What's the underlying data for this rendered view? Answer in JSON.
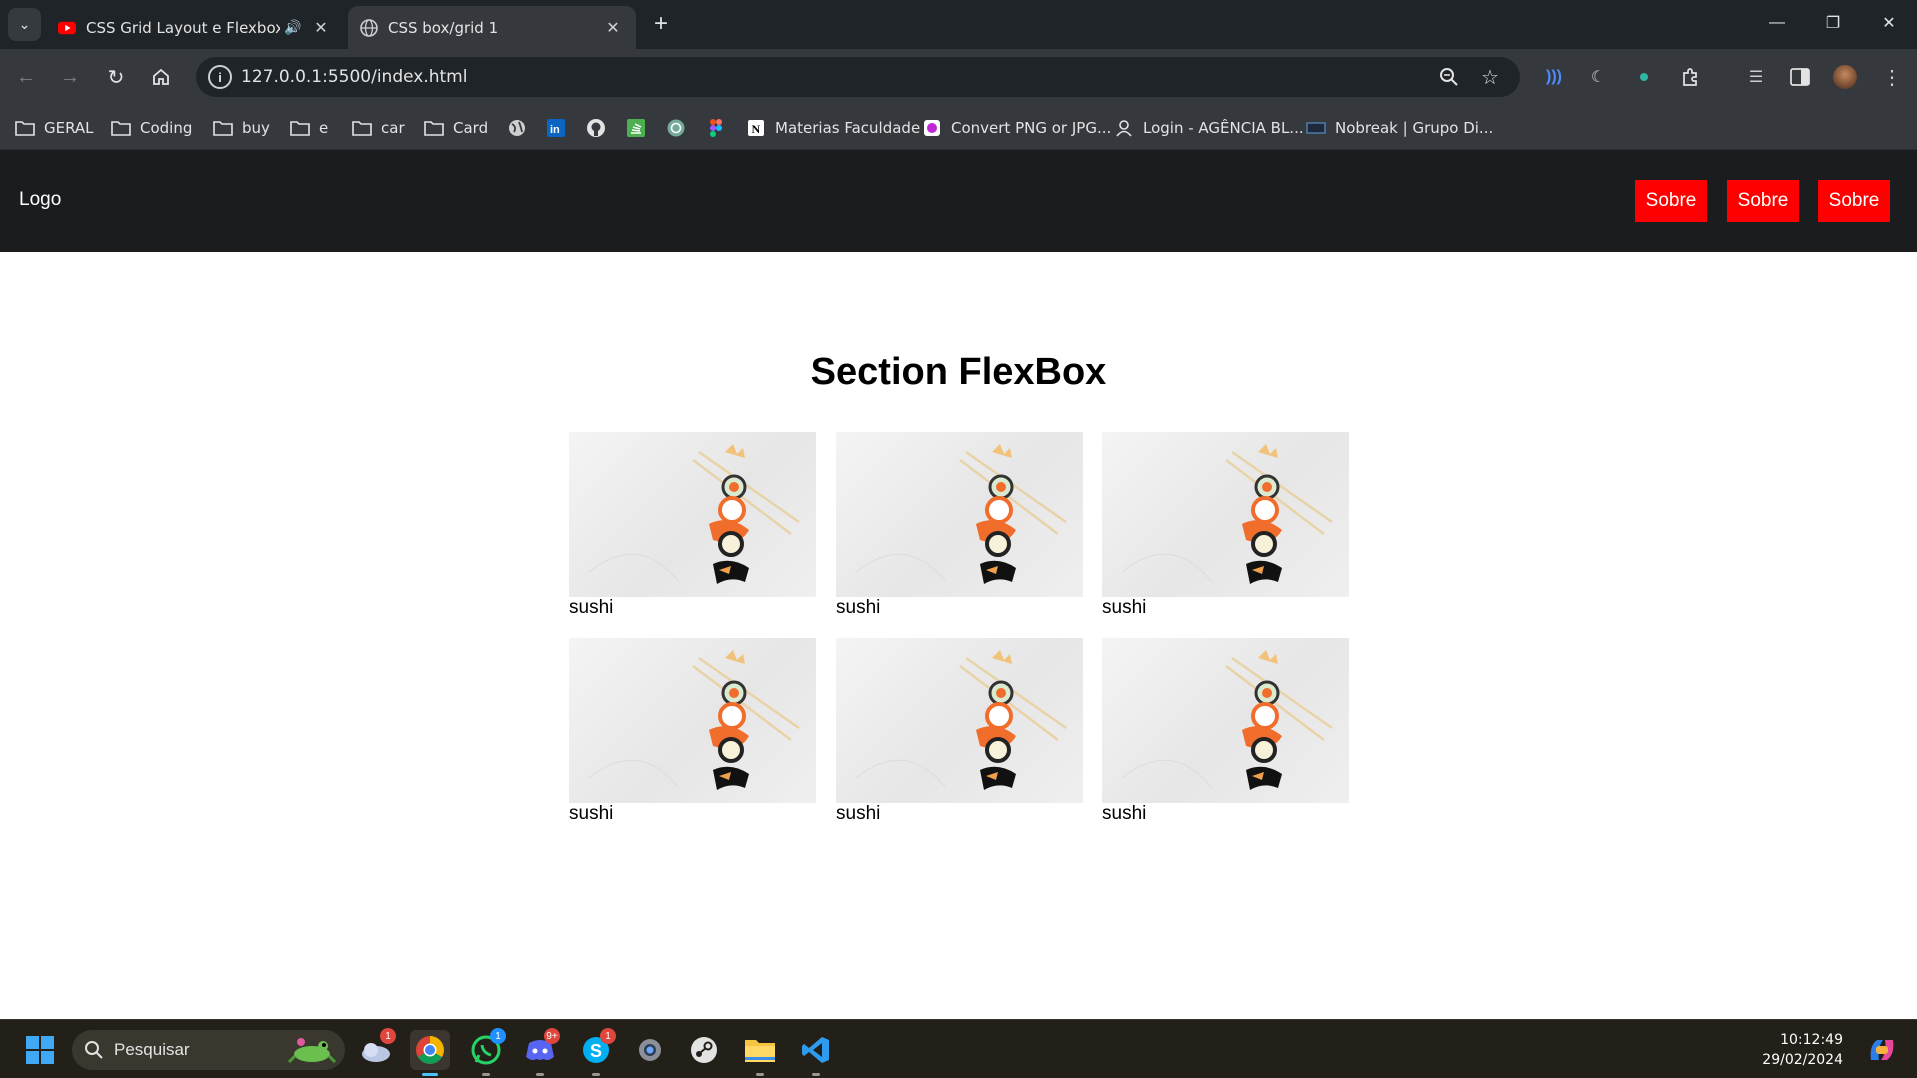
{
  "browser": {
    "tabs": [
      {
        "title": "CSS Grid Layout e Flexbox -",
        "favicon": "youtube-icon",
        "audio": true,
        "active": false
      },
      {
        "title": "CSS box/grid 1",
        "favicon": "globe-icon",
        "audio": false,
        "active": true
      }
    ],
    "address": "127.0.0.1:5500/index.html",
    "bookmarks": [
      {
        "label": "GERAL",
        "icon": "folder-icon"
      },
      {
        "label": "Coding",
        "icon": "folder-icon"
      },
      {
        "label": "buy",
        "icon": "folder-icon"
      },
      {
        "label": "e",
        "icon": "folder-icon"
      },
      {
        "label": "car",
        "icon": "folder-icon"
      },
      {
        "label": "Card",
        "icon": "folder-icon"
      },
      {
        "label": "",
        "icon": "globe-icon"
      },
      {
        "label": "",
        "icon": "linkedin-icon"
      },
      {
        "label": "",
        "icon": "github-icon"
      },
      {
        "label": "",
        "icon": "stackoverflow-icon"
      },
      {
        "label": "",
        "icon": "chatgpt-icon"
      },
      {
        "label": "",
        "icon": "figma-icon"
      },
      {
        "label": "Materias Faculdade",
        "icon": "notion-icon"
      },
      {
        "label": "Convert PNG or JPG...",
        "icon": "converter-icon"
      },
      {
        "label": "Login - AGÊNCIA BL...",
        "icon": "login-icon"
      },
      {
        "label": "Nobreak | Grupo Di...",
        "icon": "nobreak-icon"
      }
    ]
  },
  "site": {
    "logo": "Logo",
    "nav": [
      "Sobre",
      "Sobre",
      "Sobre"
    ],
    "section_title": "Section FlexBox",
    "cards": [
      {
        "caption": "sushi"
      },
      {
        "caption": "sushi"
      },
      {
        "caption": "sushi"
      },
      {
        "caption": "sushi"
      },
      {
        "caption": "sushi"
      },
      {
        "caption": "sushi"
      }
    ]
  },
  "taskbar": {
    "search_placeholder": "Pesquisar",
    "apps": [
      {
        "name": "weather-icon",
        "badge": "1"
      },
      {
        "name": "chrome-icon",
        "badge": "",
        "active": true
      },
      {
        "name": "whatsapp-icon",
        "badge": "1"
      },
      {
        "name": "discord-icon",
        "badge": "9+"
      },
      {
        "name": "skype-icon",
        "badge": "1"
      },
      {
        "name": "settings-icon",
        "badge": ""
      },
      {
        "name": "steam-icon",
        "badge": ""
      },
      {
        "name": "file-explorer-icon",
        "badge": ""
      },
      {
        "name": "vscode-icon",
        "badge": ""
      }
    ],
    "time": "10:12:49",
    "date": "29/02/2024"
  },
  "colors": {
    "header_bg": "#1b1c1e",
    "nav_button": "#ff0000",
    "browser_frame": "#1f2428",
    "toolbar": "#35393e"
  }
}
